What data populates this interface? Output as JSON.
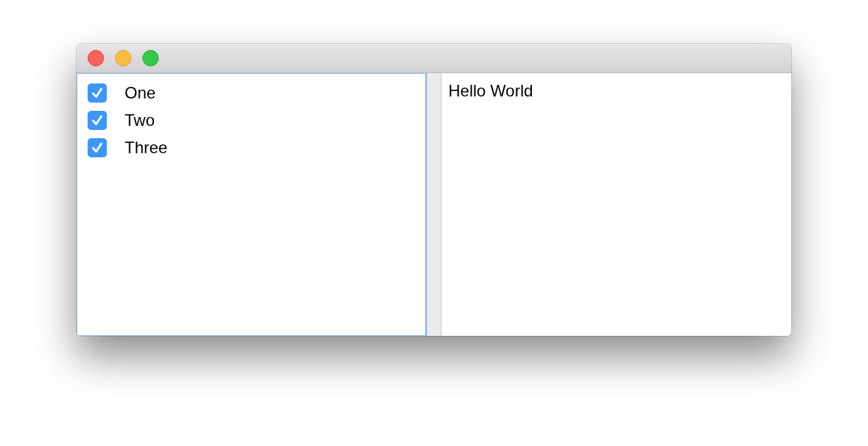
{
  "list": {
    "focused": true,
    "items": [
      {
        "label": "One",
        "checked": true
      },
      {
        "label": "Two",
        "checked": true
      },
      {
        "label": "Three",
        "checked": true
      }
    ]
  },
  "text_area": {
    "value": "Hello World"
  }
}
